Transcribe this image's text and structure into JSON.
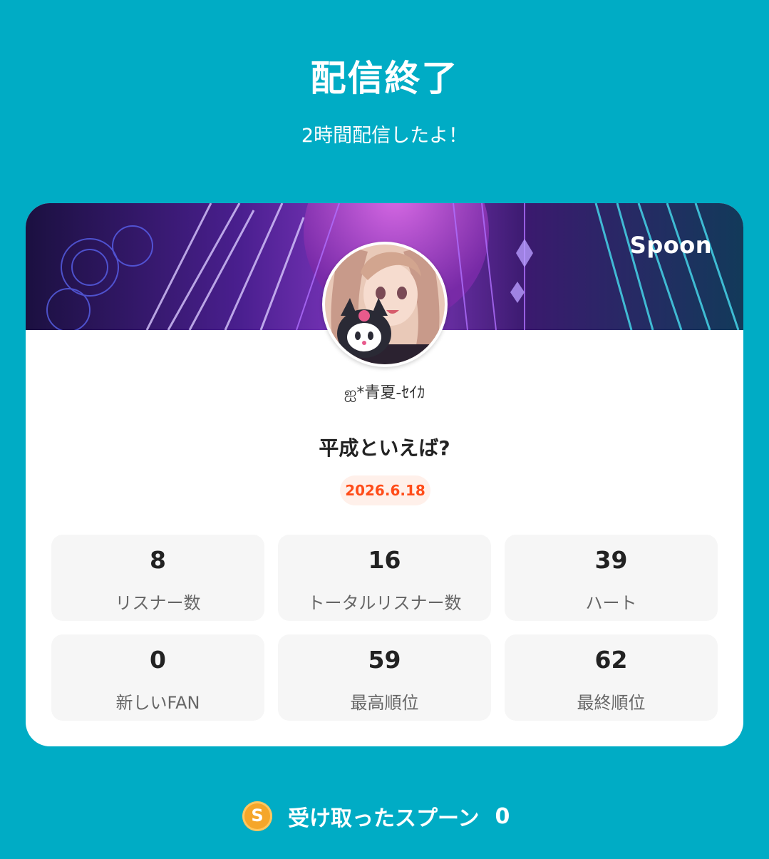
{
  "header": {
    "title": "配信終了",
    "subtitle": "2時間配信したよ！"
  },
  "card": {
    "brand": "Spoon",
    "username": "ஐ*青夏-ｾｲｶ",
    "stream_title": "平成といえば?",
    "date": "2026.6.18",
    "stats": [
      {
        "value": "8",
        "label": "リスナー数"
      },
      {
        "value": "16",
        "label": "トータルリスナー数"
      },
      {
        "value": "39",
        "label": "ハート"
      },
      {
        "value": "0",
        "label": "新しいFAN"
      },
      {
        "value": "59",
        "label": "最高順位"
      },
      {
        "value": "62",
        "label": "最終順位"
      }
    ]
  },
  "footer": {
    "coin_letter": "S",
    "spoons_label": "受け取ったスプーン",
    "spoons_count": "0"
  },
  "colors": {
    "background": "#00acc5",
    "date_text": "#ff4d1a",
    "date_bg": "#fff0ea",
    "coin": "#f5a62a"
  }
}
